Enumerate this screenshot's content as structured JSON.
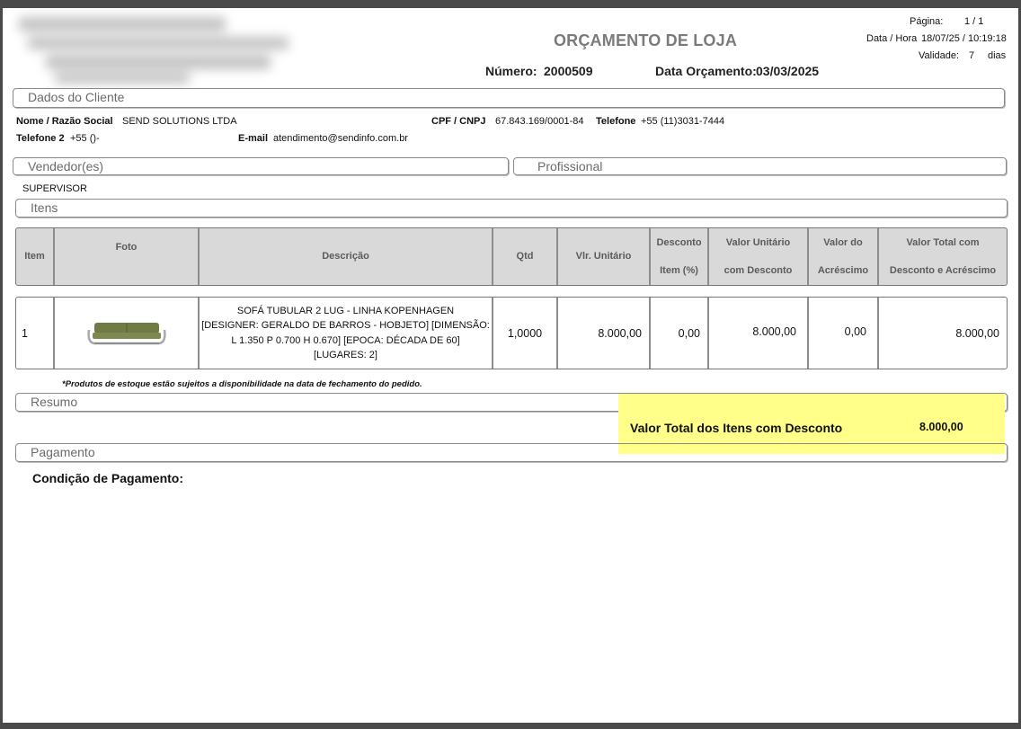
{
  "header": {
    "title": "ORÇAMENTO DE LOJA",
    "numero_label": "Número:",
    "numero_value": "2000509",
    "data_label": "Data Orçamento:",
    "data_value": "03/03/2025",
    "pagina_label": "Página:",
    "pagina_value": "1 / 1",
    "datahora_label": "Data / Hora",
    "datahora_value": "18/07/25 / 10:19:18",
    "validade_label": "Validade:",
    "validade_value": "7",
    "validade_unit": "dias"
  },
  "cliente": {
    "section_title": "Dados do Cliente",
    "nome_label": "Nome / Razão Social",
    "nome_value": "SEND SOLUTIONS LTDA",
    "cpf_label": "CPF / CNPJ",
    "cpf_value": "67.843.169/0001-84",
    "tel_label": "Telefone",
    "tel_value": "+55 (11)3031-7444",
    "tel2_label": "Telefone 2",
    "tel2_value": "+55 ()-",
    "email_label": "E-mail",
    "email_value": "atendimento@sendinfo.com.br"
  },
  "vendedor": {
    "section_title": "Vendedor(es)",
    "profissional_title": "Profissional",
    "name": "SUPERVISOR"
  },
  "itens": {
    "section_title": "Itens",
    "columns": {
      "item": "Item",
      "foto": "Foto",
      "descricao": "Descrição",
      "qtd": "Qtd",
      "vlr_unit": "Vlr. Unitário",
      "desconto_1": "Desconto",
      "desconto_2": "Item (%)",
      "vu_desc_1": "Valor Unitário",
      "vu_desc_2": "com Desconto",
      "acresc_1": "Valor do",
      "acresc_2": "Acréscimo",
      "total_1": "Valor Total com",
      "total_2": "Desconto e Acréscimo"
    },
    "rows": [
      {
        "item": "1",
        "desc_1": "SOFÁ TUBULAR 2 LUG - LINHA KOPENHAGEN",
        "desc_2": "[DESIGNER: GERALDO DE BARROS - HOBJETO] [DIMENSÃO:",
        "desc_3": "L 1.350 P 0.700 H 0.670] [EPOCA: DÉCADA DE 60]",
        "desc_4": "[LUGARES: 2]",
        "qtd": "1,0000",
        "vlr_unit": "8.000,00",
        "desconto": "0,00",
        "vu_desc": "8.000,00",
        "acresc": "0,00",
        "total": "8.000,00"
      }
    ],
    "note": "*Produtos de estoque estão sujeitos a disponibilidade na data de fechamento do pedido."
  },
  "resumo": {
    "section_title": "Resumo",
    "total_label": "Valor Total dos Itens com Desconto",
    "total_value": "8.000,00"
  },
  "pagamento": {
    "section_title": "Pagamento",
    "condicao_label": "Condição de Pagamento:"
  },
  "colors": {
    "highlight": "#ffff8a",
    "table_header": "#d9d9d9",
    "title_gray": "#7a7a7a"
  }
}
